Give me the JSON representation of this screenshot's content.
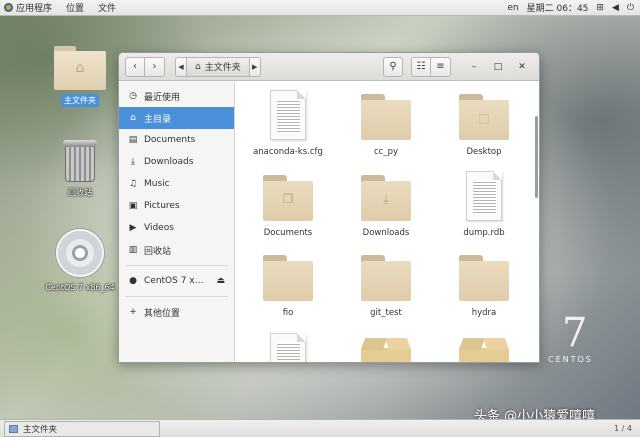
{
  "topbar": {
    "applications": "应用程序",
    "places": "位置",
    "file": "文件",
    "input_method": "en",
    "clock": "星期二 06：45",
    "icons": [
      "network-icon",
      "volume-icon",
      "power-icon"
    ]
  },
  "desktop": {
    "icons": [
      {
        "label": "主文件夹",
        "icon": "home-folder-icon",
        "selected": true
      },
      {
        "label": "回收站",
        "icon": "trash-icon"
      },
      {
        "label": "CentOS 7 x86_64",
        "icon": "disc-icon"
      }
    ],
    "watermark_number": "7",
    "watermark_text": "CENTOS"
  },
  "window": {
    "path": {
      "current": "主文件夹"
    },
    "sidebar": [
      {
        "label": "最近使用",
        "icon": "recent-icon"
      },
      {
        "label": "主目录",
        "icon": "home-icon",
        "active": true
      },
      {
        "label": "Documents",
        "icon": "documents-icon"
      },
      {
        "label": "Downloads",
        "icon": "downloads-icon"
      },
      {
        "label": "Music",
        "icon": "music-icon"
      },
      {
        "label": "Pictures",
        "icon": "pictures-icon"
      },
      {
        "label": "Videos",
        "icon": "videos-icon"
      },
      {
        "label": "回收站",
        "icon": "trash-icon"
      },
      {
        "label": "CentOS 7 x…",
        "icon": "disc-icon",
        "eject": true
      },
      {
        "label": "其他位置",
        "icon": "plus-icon"
      }
    ],
    "files": [
      {
        "name": "anaconda-ks.cfg",
        "type": "document"
      },
      {
        "name": "cc_py",
        "type": "folder"
      },
      {
        "name": "Desktop",
        "type": "folder",
        "emblem": "desktop-emblem-icon"
      },
      {
        "name": "Documents",
        "type": "folder",
        "emblem": "documents-emblem-icon"
      },
      {
        "name": "Downloads",
        "type": "folder",
        "emblem": "download-emblem-icon"
      },
      {
        "name": "dump.rdb",
        "type": "document"
      },
      {
        "name": "fio",
        "type": "folder"
      },
      {
        "name": "git_test",
        "type": "folder"
      },
      {
        "name": "hydra",
        "type": "folder"
      },
      {
        "name": "",
        "type": "document"
      },
      {
        "name": "",
        "type": "package"
      },
      {
        "name": "",
        "type": "package"
      }
    ]
  },
  "bottombar": {
    "task_label": "主文件夹",
    "workspace": "1 / 4"
  },
  "source_watermark": "头条 @小小猿爱嘻嘻"
}
